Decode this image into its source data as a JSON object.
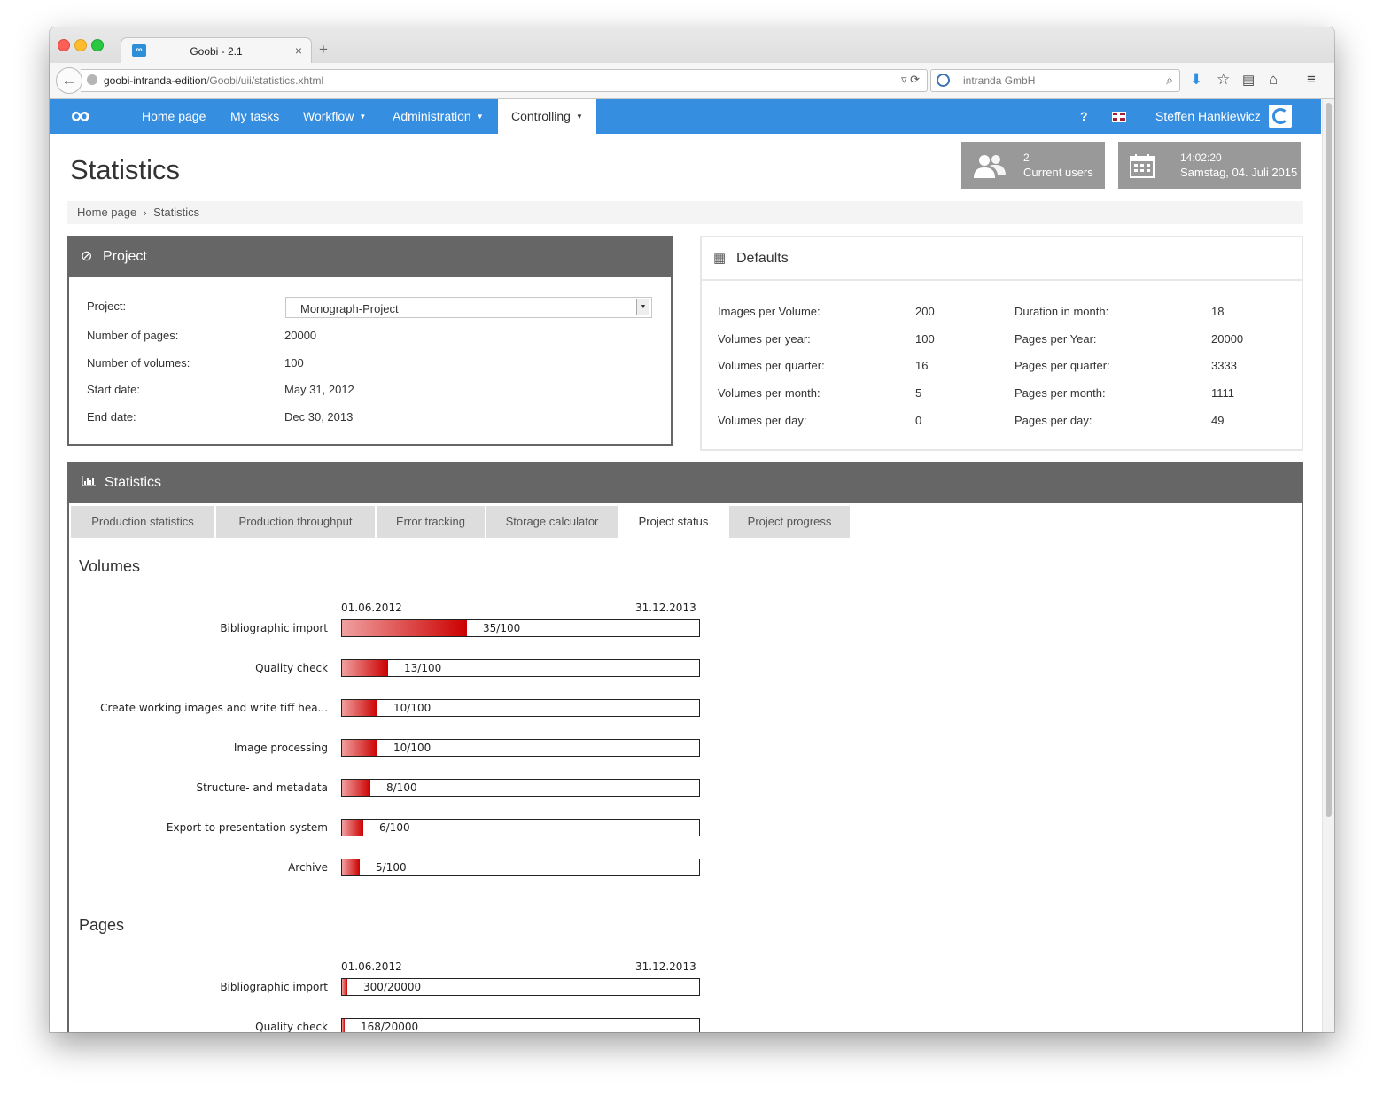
{
  "browser": {
    "tab_title": "Goobi - 2.1",
    "url_host": "goobi-intranda-edition",
    "url_path": "/Goobi/uii/statistics.xhtml",
    "search_text": "intranda GmbH"
  },
  "nav": {
    "items": [
      {
        "label": "Home page"
      },
      {
        "label": "My tasks"
      },
      {
        "label": "Workflow"
      },
      {
        "label": "Administration"
      },
      {
        "label": "Controlling"
      }
    ],
    "help": "?",
    "user": "Steffen Hankiewicz"
  },
  "header": {
    "title": "Statistics",
    "users_count": "2",
    "users_label": "Current users",
    "time": "14:02:20",
    "date": "Samstag, 04. Juli 2015"
  },
  "breadcrumb": {
    "home": "Home page",
    "sep": "›",
    "current": "Statistics"
  },
  "project_panel": {
    "title": "Project",
    "rows": [
      {
        "label": "Project:",
        "value": "Monograph-Project"
      },
      {
        "label": "Number of pages:",
        "value": "20000"
      },
      {
        "label": "Number of volumes:",
        "value": "100"
      },
      {
        "label": "Start date:",
        "value": "May 31, 2012"
      },
      {
        "label": "End date:",
        "value": "Dec 30, 2013"
      }
    ]
  },
  "defaults_panel": {
    "title": "Defaults",
    "left": [
      {
        "label": "Images per Volume:",
        "value": "200"
      },
      {
        "label": "Volumes per year:",
        "value": "100"
      },
      {
        "label": "Volumes per quarter:",
        "value": "16"
      },
      {
        "label": "Volumes per month:",
        "value": "5"
      },
      {
        "label": "Volumes per day:",
        "value": "0"
      }
    ],
    "right": [
      {
        "label": "Duration in month:",
        "value": "18"
      },
      {
        "label": "Pages per Year:",
        "value": "20000"
      },
      {
        "label": "Pages per quarter:",
        "value": "3333"
      },
      {
        "label": "Pages per month:",
        "value": "1111"
      },
      {
        "label": "Pages per day:",
        "value": "49"
      }
    ]
  },
  "stats_panel": {
    "title": "Statistics",
    "tabs": [
      {
        "label": "Production statistics"
      },
      {
        "label": "Production throughput"
      },
      {
        "label": "Error tracking"
      },
      {
        "label": "Storage calculator"
      },
      {
        "label": "Project status"
      },
      {
        "label": "Project progress"
      }
    ]
  },
  "volumes": {
    "title": "Volumes",
    "start_date": "01.06.2012",
    "end_date": "31.12.2013",
    "rows": [
      {
        "label": "Bibliographic import",
        "text": "35/100",
        "value": 35,
        "total": 100
      },
      {
        "label": "Quality check",
        "text": "13/100",
        "value": 13,
        "total": 100
      },
      {
        "label": "Create working images and write tiff hea...",
        "text": "10/100",
        "value": 10,
        "total": 100
      },
      {
        "label": "Image processing",
        "text": "10/100",
        "value": 10,
        "total": 100
      },
      {
        "label": "Structure- and metadata",
        "text": "8/100",
        "value": 8,
        "total": 100
      },
      {
        "label": "Export to presentation system",
        "text": "6/100",
        "value": 6,
        "total": 100
      },
      {
        "label": "Archive",
        "text": "5/100",
        "value": 5,
        "total": 100
      }
    ]
  },
  "pages": {
    "title": "Pages",
    "start_date": "01.06.2012",
    "end_date": "31.12.2013",
    "rows": [
      {
        "label": "Bibliographic import",
        "text": "300/20000",
        "value": 300,
        "total": 20000
      },
      {
        "label": "Quality check",
        "text": "168/20000",
        "value": 168,
        "total": 20000
      }
    ]
  },
  "colors": {
    "nav_blue": "#368ee0",
    "panel_header": "#666666",
    "bar_red": "#cc0000"
  }
}
